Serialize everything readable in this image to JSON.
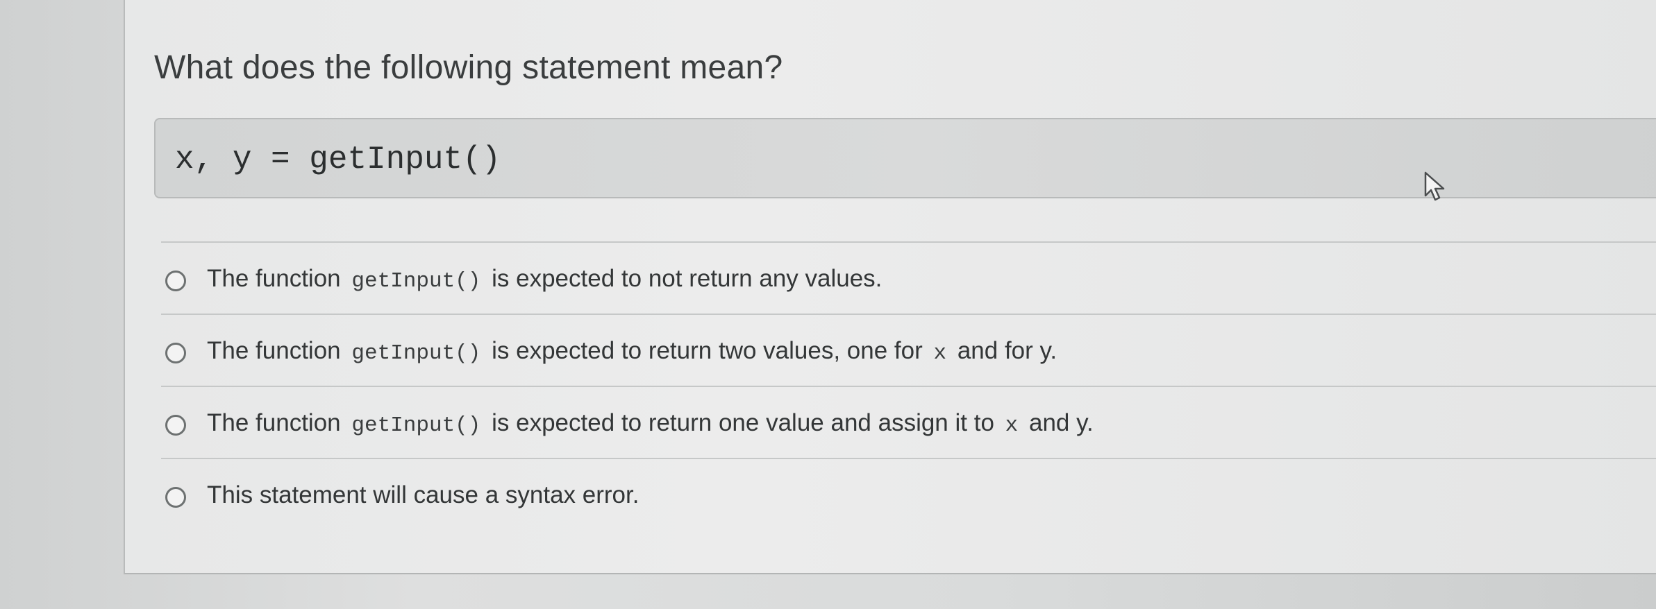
{
  "question": {
    "title": "What does the following statement mean?",
    "code": "x, y = getInput()"
  },
  "options": [
    {
      "before": "The function",
      "code": "getInput()",
      "after": "is expected to not return any values.",
      "selected": false
    },
    {
      "before": "The function",
      "code": "getInput()",
      "mid": "is expected to return two values, one for",
      "code2": "x",
      "after": "and for y.",
      "selected": false
    },
    {
      "before": "The function",
      "code": "getInput()",
      "mid": "is expected to return one value and assign it to",
      "code2": "x",
      "after": "and y.",
      "selected": false
    },
    {
      "text": "This statement will cause a syntax error.",
      "selected": false
    }
  ],
  "icons": {
    "cursor": "mouse-pointer-icon",
    "radio": "radio-button-icon"
  },
  "colors": {
    "card": "#e9eaea",
    "code_box": "#d5d7d7",
    "text": "#333637"
  }
}
